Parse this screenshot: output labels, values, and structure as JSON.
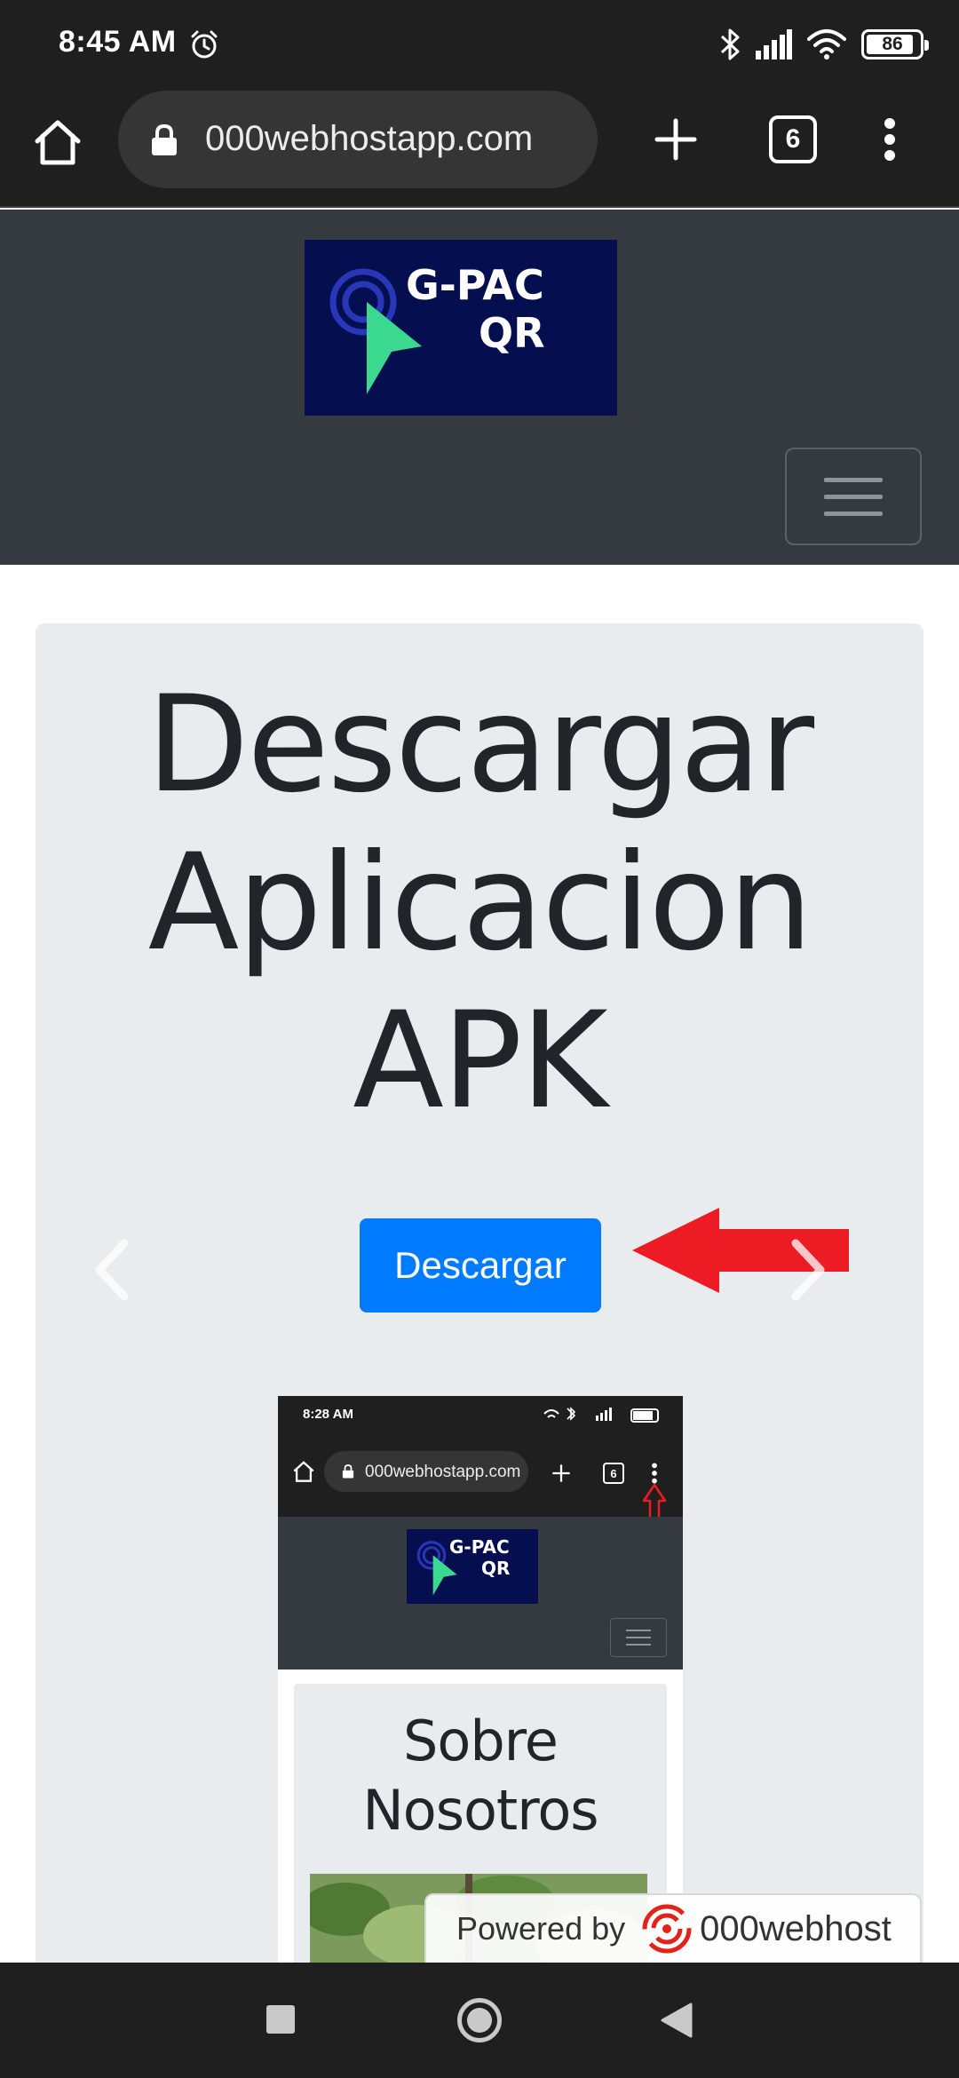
{
  "status_bar": {
    "time": "8:45 AM",
    "icons": [
      "alarm-icon",
      "bluetooth-icon",
      "signal-icon",
      "wifi-icon",
      "battery-icon"
    ],
    "battery_level": "86"
  },
  "browser": {
    "url": "000webhostapp.com",
    "tab_count": "6",
    "icons": [
      "home-icon",
      "lock-icon",
      "plus-icon",
      "more-vert-icon"
    ]
  },
  "site_header": {
    "logo_line1": "G-PAC",
    "logo_line2": "QR",
    "colors": {
      "header_bg": "#343a40",
      "logo_bg": "#050f50",
      "logo_arrow": "#3ad98f"
    }
  },
  "jumbotron": {
    "title": "Descargar Aplicacion APK",
    "download_button": "Descargar",
    "colors": {
      "bg": "#e9ecef",
      "button": "#007bff",
      "arrow": "#ed1c24"
    }
  },
  "embedded_screenshot": {
    "time": "8:28 AM",
    "url": "000webhostapp.com",
    "tab_count": "6",
    "logo_line1": "G-PAC",
    "logo_line2": "QR",
    "title": "Sobre Nosotros",
    "battery_level": "78"
  },
  "badge": {
    "powered_by": "Powered by",
    "brand": "000webhost"
  },
  "nav_bar": {
    "icons": [
      "recents-square-icon",
      "home-circle-icon",
      "back-triangle-icon"
    ]
  }
}
